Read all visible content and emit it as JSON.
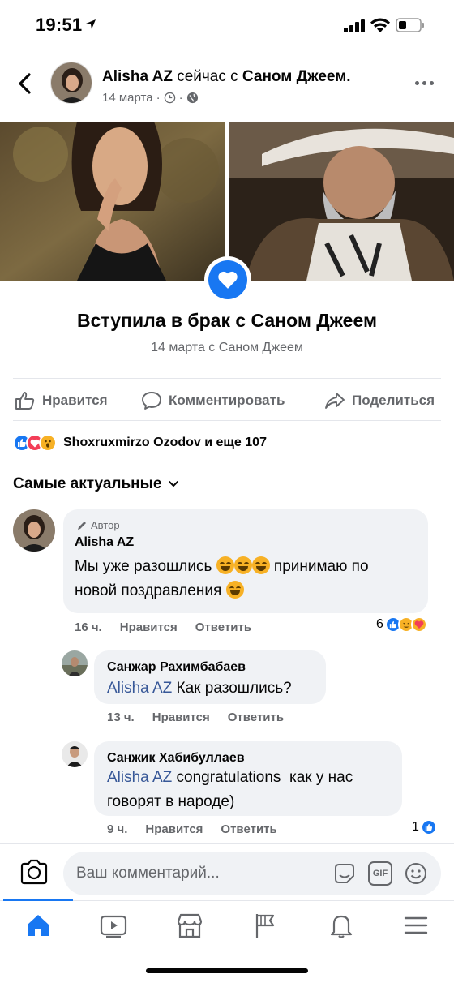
{
  "status_bar": {
    "time": "19:51"
  },
  "post": {
    "author": "Alisha AZ",
    "connector": "сейчас с",
    "with": "Саном Джеем.",
    "date": "14 марта",
    "life_event": {
      "title": "Вступила в брак с Саном Джеем",
      "subtitle": "14 марта с Саном Джеем"
    },
    "actions": {
      "like": "Нравится",
      "comment": "Комментировать",
      "share": "Поделиться"
    },
    "reactions_text": "Shoxruxmirzo Ozodov и еще 107",
    "sort_label": "Самые актуальные"
  },
  "comments": [
    {
      "author_tag": "Автор",
      "name": "Alisha AZ",
      "text_a": "Мы уже разошлись",
      "text_b": "принимаю по",
      "text_c": "новой поздравления",
      "time": "16 ч.",
      "like": "Нравится",
      "reply": "Ответить",
      "reaction_count": "6"
    },
    {
      "name": "Санжар Рахимбабаев",
      "mention": "Alisha AZ",
      "text": "Как разошлись?",
      "time": "13 ч.",
      "like": "Нравится",
      "reply": "Ответить"
    },
    {
      "name": "Санжик Хабибуллаев",
      "mention": "Alisha AZ",
      "text_a": " congratulations  как у нас",
      "text_b": "говорят в народе)",
      "time": "9 ч.",
      "like": "Нравится",
      "reply": "Ответить",
      "reaction_count": "1"
    }
  ],
  "composer": {
    "placeholder": "Ваш комментарий...",
    "gif": "GIF"
  },
  "colors": {
    "accent": "#1877f2",
    "muted": "#65676b",
    "bubble": "#f0f2f5",
    "love": "#f33e58",
    "haha": "#f7b125"
  },
  "tabs": [
    "home-icon",
    "watch-icon",
    "marketplace-icon",
    "pages-flag-icon",
    "notifications-bell-icon",
    "menu-icon"
  ]
}
